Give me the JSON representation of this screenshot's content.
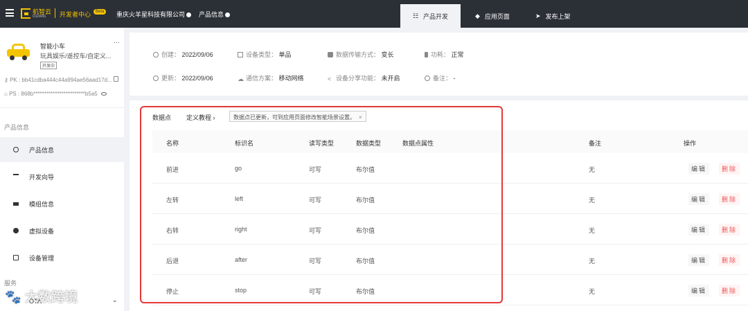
{
  "topbar": {
    "logo_cn": "机智云",
    "logo_en": "Gizwits",
    "dev_center": "开发者中心",
    "beta": "Beta",
    "company": "重庆火羊星科技有限公司",
    "product_info": "产品信息",
    "tabs": [
      {
        "label": "产品开发",
        "icon": "tuning-icon",
        "active": true
      },
      {
        "label": "应用页面",
        "icon": "diamond-icon",
        "active": false
      },
      {
        "label": "发布上架",
        "icon": "send-icon",
        "active": false
      }
    ]
  },
  "product": {
    "name": "智能小车",
    "category": "玩具娱乐/遥控车/自定义...",
    "status_badge": "开发中",
    "pk": "PK : bb41cdba444c44a994ae56aad17d...",
    "ps": "PS : 868b************************b5a5"
  },
  "sidebar": {
    "section1": "产品信息",
    "items": [
      {
        "label": "产品信息",
        "icon": "info-icon",
        "active": true
      },
      {
        "label": "开发向导",
        "icon": "pin-icon",
        "active": false
      },
      {
        "label": "模组信息",
        "icon": "module-icon",
        "active": false
      },
      {
        "label": "虚拟设备",
        "icon": "device-icon",
        "active": false
      },
      {
        "label": "设备管理",
        "icon": "box-icon",
        "active": false
      }
    ],
    "section2": "服务",
    "ota": "OTA"
  },
  "info": {
    "created_label": "创建：",
    "created": "2022/09/06",
    "updated_label": "更新：",
    "updated": "2022/09/06",
    "device_type_label": "设备类型：",
    "device_type": "单品",
    "comm_label": "通信方案：",
    "comm": "移动网络",
    "transfer_label": "数据传输方式：",
    "transfer": "变长",
    "share_label": "设备分享功能：",
    "share": "未开启",
    "power_label": "功耗：",
    "power": "正常",
    "note_label": "备注：",
    "note": "-"
  },
  "datapoints": {
    "tab": "数据点",
    "guide": "定义教程 ›",
    "notice": "数据点已更新，可到应用页面修改智能场景设置。",
    "notice_close": "×",
    "headers": [
      "名称",
      "标识名",
      "读写类型",
      "数据类型",
      "数据点属性",
      "备注",
      "操作"
    ],
    "rows": [
      {
        "name": "前进",
        "id": "go",
        "rw": "可写",
        "type": "布尔值",
        "note": "无"
      },
      {
        "name": "左转",
        "id": "left",
        "rw": "可写",
        "type": "布尔值",
        "note": "无"
      },
      {
        "name": "右转",
        "id": "right",
        "rw": "可写",
        "type": "布尔值",
        "note": "无"
      },
      {
        "name": "后退",
        "id": "after",
        "rw": "可写",
        "type": "布尔值",
        "note": "无"
      },
      {
        "name": "停止",
        "id": "stop",
        "rw": "可写",
        "type": "布尔值",
        "note": "无"
      }
    ],
    "edit": "编辑",
    "delete": "删除"
  },
  "watermark": "大数跨境"
}
